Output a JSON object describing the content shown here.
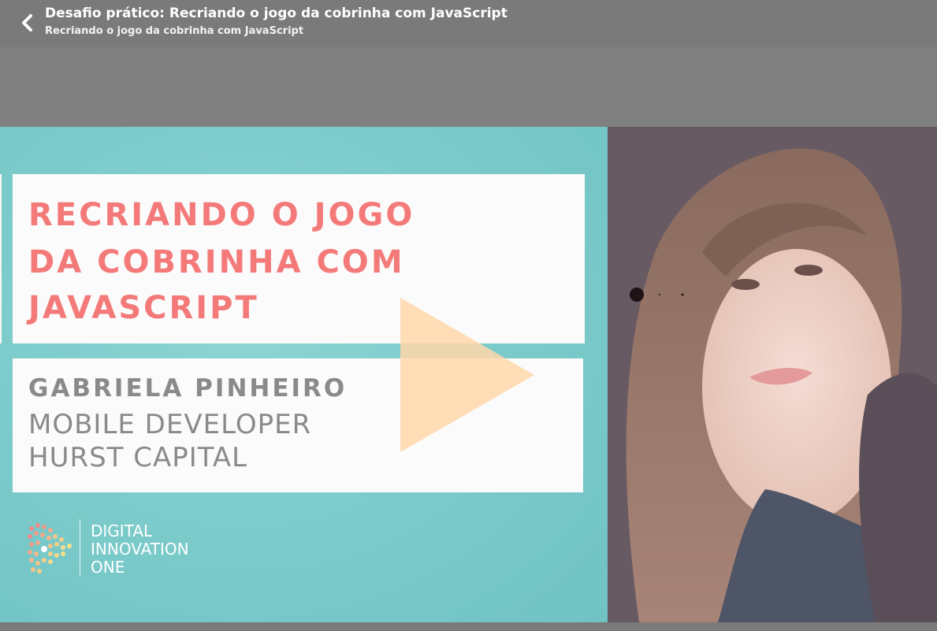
{
  "header": {
    "back_icon": "chevron-left-icon",
    "title": "Desafio prático: Recriando o jogo da cobrinha com JavaScript",
    "subtitle": "Recriando o jogo da cobrinha com JavaScript"
  },
  "video": {
    "slide": {
      "title_lines": [
        "RECRIANDO O JOGO",
        "DA COBRINHA COM",
        "JAVASCRIPT"
      ],
      "presenter_name": "GABRIELA PINHEIRO",
      "presenter_role": "MOBILE DEVELOPER",
      "presenter_company": "HURST CAPITAL",
      "logo_lines": [
        "DIGITAL",
        "INNOVATION",
        "ONE"
      ]
    },
    "play_icon": "play-icon",
    "colors": {
      "slide_bg": "#7ccbcb",
      "title_color": "#f47a7a",
      "play_color": "#ffd7aa",
      "overlay": "#808080"
    }
  }
}
